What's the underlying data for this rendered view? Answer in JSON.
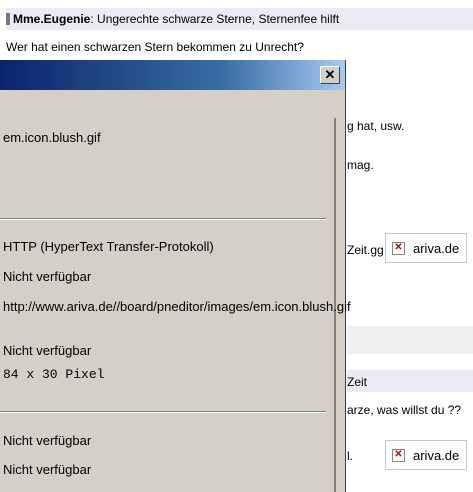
{
  "post": {
    "author": "Mme.Eugenie",
    "title": ": Ungerechte schwarze Sterne, Sternenfee hilft",
    "question": "Wer hat einen schwarzen Stern bekommen zu Unrecht?",
    "fragments": [
      "g hat, usw.",
      "mag.",
      "Zeit.gg",
      "Zeit",
      "arze, was willst du ??",
      "l."
    ],
    "image_caption_1": "ariva.de",
    "image_caption_2": "ariva.de"
  },
  "dialog": {
    "close_symbol": "✕",
    "filename": "em.icon.blush.gif",
    "protocol": "HTTP (HyperText Transfer-Protokoll)",
    "type": "Nicht verfügbar",
    "address": "http://www.ariva.de//board/pneditor/images/em.icon.blush.gif",
    "size": "Nicht verfügbar",
    "dimensions": "84 x 30 Pixel",
    "created": "Nicht verfügbar",
    "modified": "Nicht verfügbar"
  },
  "icons": {
    "broken_image": "broken-image-icon",
    "close": "close-icon"
  }
}
